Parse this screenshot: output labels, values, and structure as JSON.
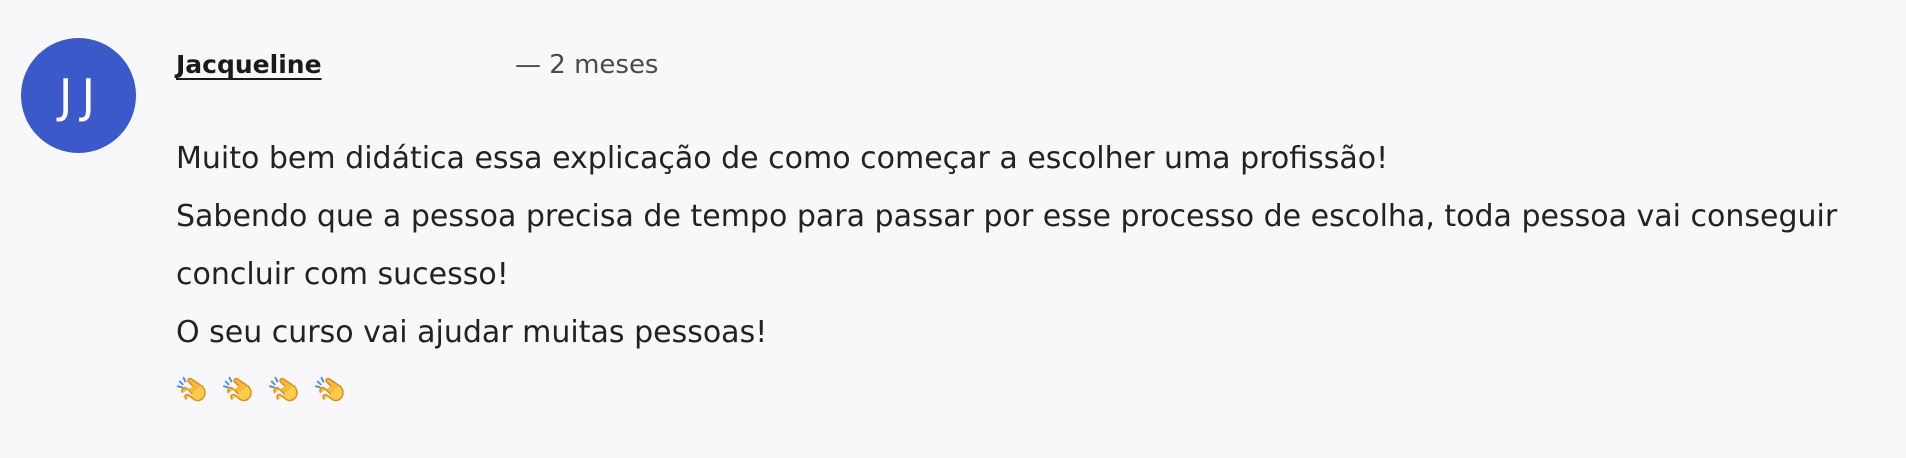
{
  "review": {
    "avatar_initials": "JJ",
    "avatar_color": "#3b59c8",
    "author": "Jacqueline ",
    "time": "— 2 meses",
    "lines": [
      "Muito bem didática essa explicação de como começar a escolher uma profissão!",
      "Sabendo que a pessoa precisa de tempo para passar por esse processo de escolha, toda pessoa vai conseguir",
      "concluir com sucesso!",
      "O seu curso vai ajudar muitas pessoas!"
    ],
    "emoji_icons": [
      "clapping-hands-icon",
      "clapping-hands-icon",
      "clapping-hands-icon",
      "clapping-hands-icon"
    ]
  }
}
